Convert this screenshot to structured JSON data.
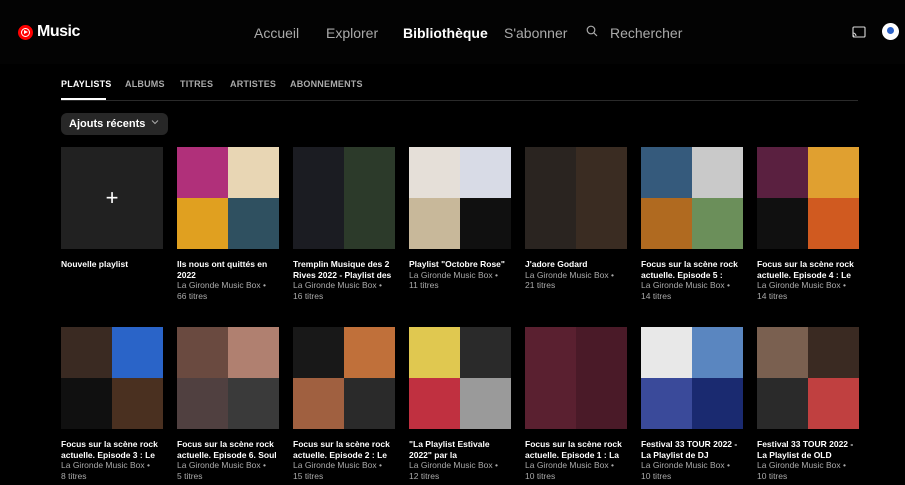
{
  "header": {
    "logo_text": "Music",
    "nav": [
      "Accueil",
      "Explorer",
      "Bibliothèque",
      "S'abonner"
    ],
    "search_label": "Rechercher"
  },
  "tabs": [
    "PLAYLISTS",
    "ALBUMS",
    "TITRES",
    "ARTISTES",
    "ABONNEMENTS"
  ],
  "sort_chip": "Ajouts récents",
  "new_playlist": {
    "title": "Nouvelle playlist"
  },
  "playlists_row1": [
    {
      "title": "Ils nous ont quittés en 2022",
      "author": "La Gironde Music Box •",
      "count": "66 titres",
      "colors": [
        "#b0307a",
        "#e8d6b4",
        "#e0a020",
        "#2f5060"
      ]
    },
    {
      "title": "Tremplin Musique des 2 Rives 2022 - Playlist des",
      "author": "La Gironde Music Box •",
      "count": "16 titres",
      "colors": [
        "#1b1c22",
        "#2c3a2a",
        "#1b1c22",
        "#2c3a2a"
      ]
    },
    {
      "title": "Playlist \"Octobre Rose\"",
      "author": "La Gironde Music Box •",
      "count": "11 titres",
      "colors": [
        "#e5dfd8",
        "#d8dbe6",
        "#c8b89a",
        "#101010"
      ]
    },
    {
      "title": "J'adore Godard",
      "author": "La Gironde Music Box •",
      "count": "21 titres",
      "colors": [
        "#2a2420",
        "#3a2c22",
        "#2a2420",
        "#3a2c22"
      ]
    },
    {
      "title": "Focus sur la scène rock actuelle. Episode 5 :",
      "author": "La Gironde Music Box •",
      "count": "14 titres",
      "colors": [
        "#355a7c",
        "#c9c9c9",
        "#b06a20",
        "#6b8f5a"
      ]
    },
    {
      "title": "Focus sur la scène rock actuelle. Episode 4 : Le",
      "author": "La Gironde Music Box •",
      "count": "14 titres",
      "colors": [
        "#5a2040",
        "#e0a030",
        "#101010",
        "#d05a20"
      ]
    }
  ],
  "playlists_row2": [
    {
      "title": "Focus sur la scène rock actuelle. Episode 3 : Le",
      "author": "La Gironde Music Box •",
      "count": "8 titres",
      "colors": [
        "#3a2a22",
        "#2a64c8",
        "#101010",
        "#4a3020"
      ]
    },
    {
      "title": "Focus sur la scène rock actuelle. Episode 6. Soul",
      "author": "La Gironde Music Box •",
      "count": "5 titres",
      "colors": [
        "#6a4a40",
        "#b08070",
        "#504040",
        "#3a3a3a"
      ]
    },
    {
      "title": "Focus sur la scène rock actuelle. Episode 2 : Le",
      "author": "La Gironde Music Box •",
      "count": "15 titres",
      "colors": [
        "#181818",
        "#c0703a",
        "#a06040",
        "#2a2a2a"
      ]
    },
    {
      "title": "\"La Playlist Estivale 2022\" par la",
      "author": "La Gironde Music Box •",
      "count": "12 titres",
      "colors": [
        "#e0c850",
        "#2a2a2a",
        "#c03040",
        "#9a9a9a"
      ]
    },
    {
      "title": "Focus sur la scène rock actuelle. Episode 1 : La",
      "author": "La Gironde Music Box •",
      "count": "10 titres",
      "colors": [
        "#5a2030",
        "#4a1a28",
        "#5a2030",
        "#4a1a28"
      ]
    },
    {
      "title": "Festival 33 TOUR 2022 - La Playlist de DJ",
      "author": "La Gironde Music Box •",
      "count": "10 titres",
      "colors": [
        "#e8e8e8",
        "#5a86c0",
        "#3a4a9a",
        "#1a2a70"
      ]
    },
    {
      "title": "Festival 33 TOUR 2022 - La Playlist de OLD",
      "author": "La Gironde Music Box •",
      "count": "10 titres",
      "colors": [
        "#7a6050",
        "#3a2a22",
        "#2a2a2a",
        "#c04040"
      ]
    }
  ]
}
